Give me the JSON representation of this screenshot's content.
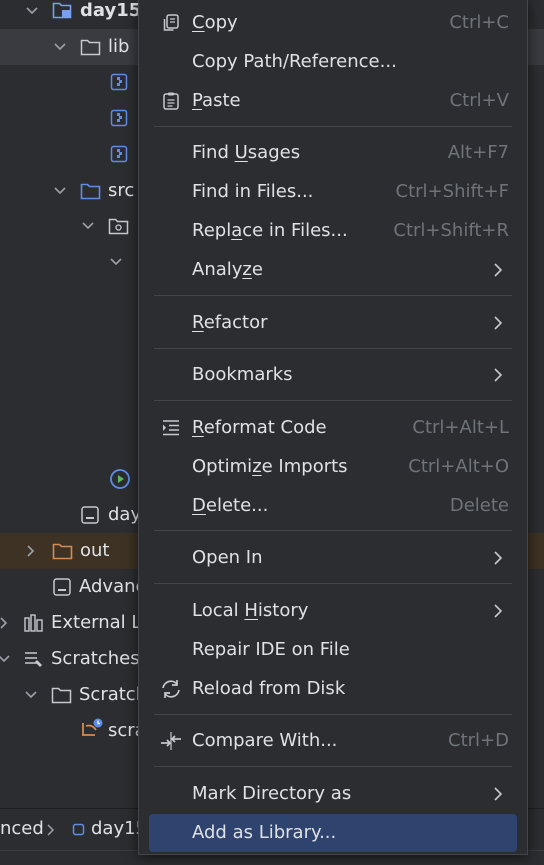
{
  "project_tree": {
    "items": [
      {
        "label": "day15"
      },
      {
        "label": "lib"
      },
      {
        "label": "src"
      },
      {
        "label": "day"
      },
      {
        "label": "out"
      },
      {
        "label": "Advanc"
      },
      {
        "label": "External Li"
      },
      {
        "label": "Scratches"
      },
      {
        "label": "Scratch"
      },
      {
        "label": "scra"
      }
    ]
  },
  "breadcrumb": {
    "part1": "nced",
    "part2": "day15"
  },
  "context_menu": {
    "items": [
      {
        "pre": "",
        "u": "C",
        "post": "opy",
        "shortcut": "Ctrl+C",
        "icon": "copy-icon"
      },
      {
        "pre": "Copy Path/Reference...",
        "u": "",
        "post": "",
        "shortcut": ""
      },
      {
        "pre": "",
        "u": "P",
        "post": "aste",
        "shortcut": "Ctrl+V",
        "icon": "paste-icon"
      },
      {
        "pre": "Find ",
        "u": "U",
        "post": "sages",
        "shortcut": "Alt+F7"
      },
      {
        "pre": "Find in Files...",
        "u": "",
        "post": "",
        "shortcut": "Ctrl+Shift+F"
      },
      {
        "pre": "Repl",
        "u": "a",
        "post": "ce in Files...",
        "shortcut": "Ctrl+Shift+R"
      },
      {
        "pre": "Analy",
        "u": "z",
        "post": "e",
        "shortcut": "",
        "submenu": true
      },
      {
        "pre": "",
        "u": "R",
        "post": "efactor",
        "shortcut": "",
        "submenu": true
      },
      {
        "pre": "Bookmarks",
        "u": "",
        "post": "",
        "shortcut": "",
        "submenu": true
      },
      {
        "pre": "",
        "u": "R",
        "post": "eformat Code",
        "shortcut": "Ctrl+Alt+L",
        "icon": "reformat-icon"
      },
      {
        "pre": "Optimi",
        "u": "z",
        "post": "e Imports",
        "shortcut": "Ctrl+Alt+O"
      },
      {
        "pre": "",
        "u": "D",
        "post": "elete...",
        "shortcut": "Delete"
      },
      {
        "pre": "Open In",
        "u": "",
        "post": "",
        "shortcut": "",
        "submenu": true
      },
      {
        "pre": "Local ",
        "u": "H",
        "post": "istory",
        "shortcut": "",
        "submenu": true
      },
      {
        "pre": "Repair IDE on File",
        "u": "",
        "post": "",
        "shortcut": ""
      },
      {
        "pre": "Reload from Disk",
        "u": "",
        "post": "",
        "shortcut": "",
        "icon": "reload-icon"
      },
      {
        "pre": "Compare With...",
        "u": "",
        "post": "",
        "shortcut": "Ctrl+D",
        "icon": "compare-icon"
      },
      {
        "pre": "Mark Directory as",
        "u": "",
        "post": "",
        "shortcut": "",
        "submenu": true
      },
      {
        "pre": "Add as Library...",
        "u": "",
        "post": "",
        "shortcut": "",
        "highlighted": true
      }
    ]
  },
  "colors": {
    "background": "#2b2d30",
    "highlight": "#2e436e",
    "folder_icon": "#7a9fef",
    "out_folder_icon": "#d28c54"
  }
}
